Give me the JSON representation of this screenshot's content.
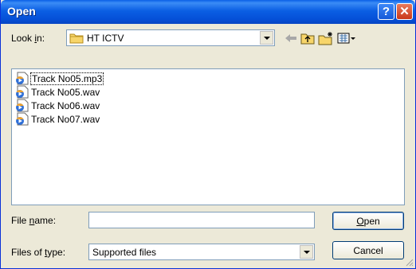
{
  "titlebar": {
    "title": "Open",
    "help_glyph": "?",
    "close_glyph": "✕"
  },
  "lookin": {
    "label_pre": "Look ",
    "label_accel": "i",
    "label_post": "n:",
    "value": "HT ICTV",
    "folder_icon": "folder-icon"
  },
  "toolbar": {
    "back_icon": "back-arrow-icon",
    "up_icon": "up-folder-icon",
    "new_folder_icon": "new-folder-icon",
    "views_icon": "view-menu-icon"
  },
  "files": [
    {
      "name": "Track No05.mp3",
      "icon": "media-file-icon"
    },
    {
      "name": "Track No05.wav",
      "icon": "media-file-icon"
    },
    {
      "name": "Track No06.wav",
      "icon": "media-file-icon"
    },
    {
      "name": "Track No07.wav",
      "icon": "media-file-icon"
    }
  ],
  "filename": {
    "label_pre": "File ",
    "label_accel": "n",
    "label_post": "ame:",
    "value": ""
  },
  "filetype": {
    "label_pre": "Files of ",
    "label_accel": "t",
    "label_post": "ype:",
    "value": "Supported files"
  },
  "buttons": {
    "open_accel": "O",
    "open_rest": "pen",
    "cancel": "Cancel"
  },
  "colors": {
    "titlebar": "#0b5fe3",
    "window_bg": "#ece9d8",
    "field_border": "#7f9db9"
  }
}
